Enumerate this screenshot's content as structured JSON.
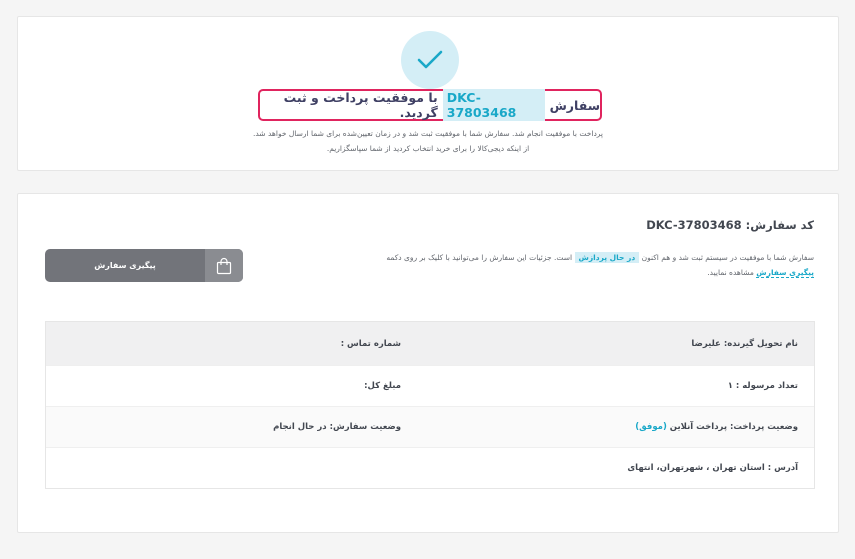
{
  "success": {
    "prefix": "سفارش",
    "order_code": "DKC-37803468",
    "suffix": "با موفقیت پرداخت و ثبت گردید.",
    "line1": "پرداخت با موفقیت انجام شد. سفارش شما با موفقیت ثبت شد و در زمان تعیین‌شده برای شما ارسال خواهد شد.",
    "line2": "از اینکه دیجی‌کالا را برای خرید انتخاب کردید از شما سپاسگزاریم."
  },
  "order": {
    "title_label": "کد سفارش:",
    "title_code": "DKC-37803468",
    "desc_part1": "سفارش شما با موفقیت در سیستم ثبت شد و هم اکنون",
    "status_badge": "در حال پردازش",
    "desc_part2": "است. جزئیات این سفارش را می‌توانید با کلیک بر روی دکمه",
    "track_link": "پیگیری سفارش",
    "desc_part3": "مشاهده نمایید.",
    "track_button": "پیگیری سفارش"
  },
  "info": {
    "recipient": "نام تحویل گیرنده: علیرضا",
    "phone": "شماره تماس :",
    "parcels": "تعداد مرسوله : ۱",
    "total": "مبلغ کل:",
    "payment_status": "وضعیت پرداخت: پرداخت آنلاین",
    "payment_ok": "(موفق)",
    "order_status": "وضعیت سفارش: در حال انجام",
    "address": "آدرس : استان تهران ، شهرتهران، انتهای"
  },
  "colors": {
    "accent": "#19a8c8",
    "highlight_bg": "#d4eef6",
    "border_red": "#e0245e",
    "button_bg": "#72747a"
  },
  "icons": {
    "check": "check-icon",
    "bag": "shopping-bag-icon"
  }
}
